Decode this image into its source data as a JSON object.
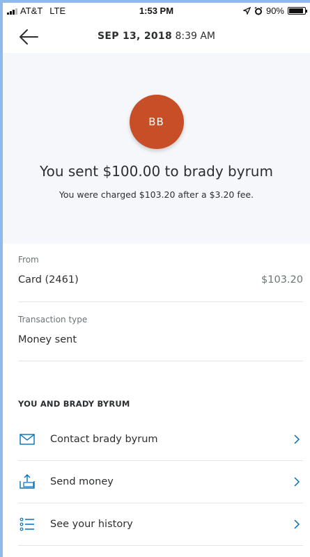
{
  "status_bar": {
    "carrier": "AT&T",
    "network": "LTE",
    "time": "1:53 PM",
    "battery": "90%",
    "battery_level": 0.9,
    "icons": [
      "location-arrow-icon",
      "alarm-clock-icon",
      "battery-icon",
      "signal-icon"
    ]
  },
  "header": {
    "date": "SEP 13, 2018",
    "time": "8:39 AM",
    "back_icon": "arrow-left-icon"
  },
  "hero": {
    "avatar_initials": "BB",
    "avatar_color": "#c74e26",
    "title": "You sent $100.00 to brady byrum",
    "subtitle": "You were charged $103.20 after a $3.20 fee."
  },
  "details": {
    "from_label": "From",
    "from_value": "Card (2461)",
    "from_amount": "$103.20",
    "type_label": "Transaction type",
    "type_value": "Money sent"
  },
  "relationship": {
    "heading": "YOU AND BRADY BYRUM",
    "actions": [
      {
        "label": "Contact brady byrum",
        "icon": "envelope-icon"
      },
      {
        "label": "Send money",
        "icon": "send-money-icon"
      },
      {
        "label": "See your history",
        "icon": "list-icon"
      }
    ]
  },
  "colors": {
    "accent": "#0070ba",
    "hero_bg": "#f5f7fa",
    "text": "#2c2e2f",
    "muted": "#6c7378"
  }
}
